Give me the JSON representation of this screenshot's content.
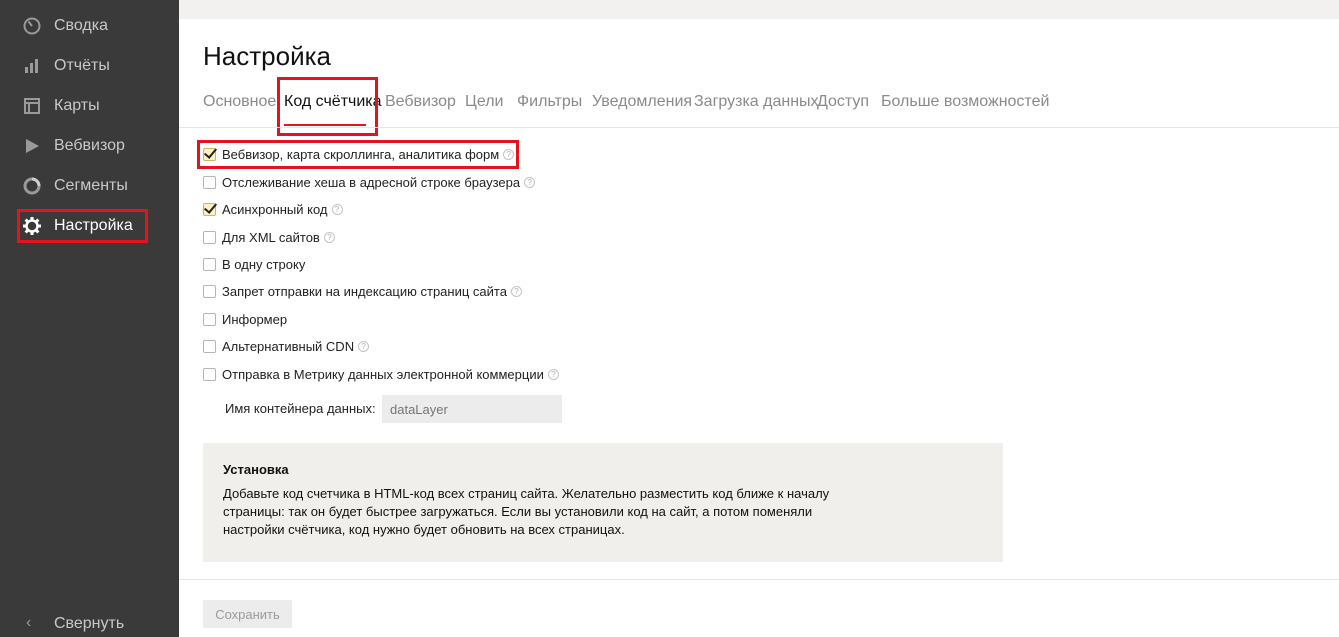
{
  "sidebar": {
    "items": [
      {
        "label": "Сводка",
        "icon": "gauge-icon"
      },
      {
        "label": "Отчёты",
        "icon": "bar-chart-icon"
      },
      {
        "label": "Карты",
        "icon": "map-layout-icon"
      },
      {
        "label": "Вебвизор",
        "icon": "play-icon"
      },
      {
        "label": "Сегменты",
        "icon": "segments-icon"
      },
      {
        "label": "Настройка",
        "icon": "gear-icon",
        "active": true
      }
    ],
    "collapse_label": "Свернуть"
  },
  "page": {
    "title": "Настройка"
  },
  "tabs": [
    {
      "label": "Основное"
    },
    {
      "label": "Код счётчика",
      "active": true
    },
    {
      "label": "Вебвизор"
    },
    {
      "label": "Цели"
    },
    {
      "label": "Фильтры"
    },
    {
      "label": "Уведомления"
    },
    {
      "label": "Загрузка данных"
    },
    {
      "label": "Доступ"
    },
    {
      "label": "Больше возможностей"
    }
  ],
  "options": [
    {
      "label": "Вебвизор, карта скроллинга, аналитика форм",
      "checked": true,
      "help": true
    },
    {
      "label": "Отслеживание хеша в адресной строке браузера",
      "checked": false,
      "help": true
    },
    {
      "label": "Асинхронный код",
      "checked": true,
      "help": true
    },
    {
      "label": "Для XML сайтов",
      "checked": false,
      "help": true
    },
    {
      "label": "В одну строку",
      "checked": false,
      "help": false
    },
    {
      "label": "Запрет отправки на индексацию страниц сайта",
      "checked": false,
      "help": true
    },
    {
      "label": "Информер",
      "checked": false,
      "help": false
    },
    {
      "label": "Альтернативный CDN",
      "checked": false,
      "help": true
    },
    {
      "label": "Отправка в Метрику данных электронной коммерции",
      "checked": false,
      "help": true
    }
  ],
  "container_field": {
    "label": "Имя контейнера данных:",
    "placeholder": "dataLayer"
  },
  "install": {
    "title": "Установка",
    "text": "Добавьте код счетчика в HTML-код всех страниц сайта. Желательно разместить код ближе к началу страницы: так он будет быстрее загружаться. Если вы установили код на сайт, а потом поменяли настройки счётчика, код нужно будет обновить на всех страницах."
  },
  "save_label": "Сохранить",
  "colors": {
    "sidebar_bg": "#3a3a3a",
    "highlight_red": "#e3141d",
    "checkbox_checked": "#fdf1bf",
    "infobox_bg": "#f1efeb"
  }
}
